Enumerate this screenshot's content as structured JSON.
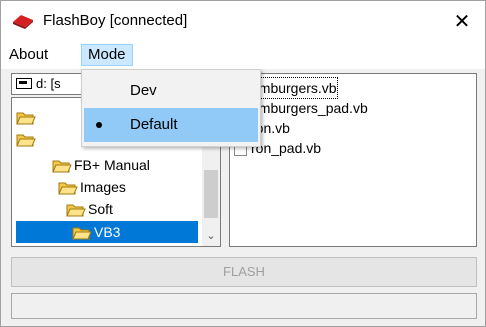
{
  "window": {
    "title": "FlashBoy  [connected]",
    "close_glyph": "✕",
    "app_icon": "flash-chip-icon"
  },
  "menubar": {
    "items": [
      {
        "label": "About"
      },
      {
        "label": "Mode"
      }
    ]
  },
  "mode_menu": {
    "items": [
      {
        "label": "Dev",
        "selected": false
      },
      {
        "label": "Default",
        "selected": true
      }
    ]
  },
  "drive": {
    "label": "d: [s"
  },
  "tree": {
    "items": [
      {
        "label": ""
      },
      {
        "label": ""
      },
      {
        "label": "FB+ Manual"
      },
      {
        "label": "Images"
      },
      {
        "label": "Soft"
      },
      {
        "label": "VB3",
        "selected": true
      }
    ]
  },
  "files": {
    "items": [
      {
        "label": "amburgers.vb"
      },
      {
        "label": "amburgers_pad.vb"
      },
      {
        "label": "ron.vb"
      },
      {
        "label": "ron_pad.vb"
      }
    ]
  },
  "flash_button": {
    "label": "FLASH",
    "enabled": false
  },
  "colors": {
    "selection": "#0078d7",
    "menu_active": "#cce8ff",
    "dropdown_hover": "#91c9f7",
    "folder": "#f5c843"
  }
}
